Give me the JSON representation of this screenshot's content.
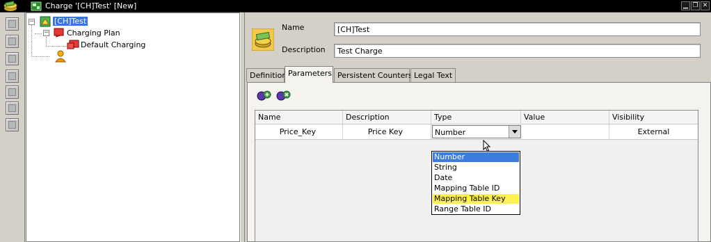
{
  "window": {
    "title": "Charge '[CH]Test' [New]",
    "controls": [
      "▁",
      "❐",
      "✕"
    ]
  },
  "tree": {
    "root": "[CH]Test",
    "child": "Charging Plan",
    "grandchild": "Default Charging",
    "expander_root": "−",
    "expander_child": "−"
  },
  "form": {
    "name_label": "Name",
    "name_value": "[CH]Test",
    "description_label": "Description",
    "description_value": "Test Charge"
  },
  "tabs": [
    {
      "label": "Definition"
    },
    {
      "label": "Parameters",
      "active": true
    },
    {
      "label": "Persistent Counters"
    },
    {
      "label": "Legal Text"
    }
  ],
  "grid": {
    "columns": [
      "Name",
      "Description",
      "Type",
      "Value",
      "Visibility"
    ],
    "rows": [
      {
        "name": "Price_Key",
        "description": "Price Key",
        "type": "Number",
        "value": "",
        "visibility": "External"
      }
    ]
  },
  "dropdown": {
    "options": [
      "Number",
      "String",
      "Date",
      "Mapping Table ID",
      "Mapping Table Key",
      "Range Table ID"
    ],
    "selected": "Number",
    "hovered": "Mapping Table Key"
  },
  "colors": {
    "selection_blue": "#3b7ddd",
    "hover_yellow": "#fff14e",
    "tree_selection": "#3875d7"
  }
}
